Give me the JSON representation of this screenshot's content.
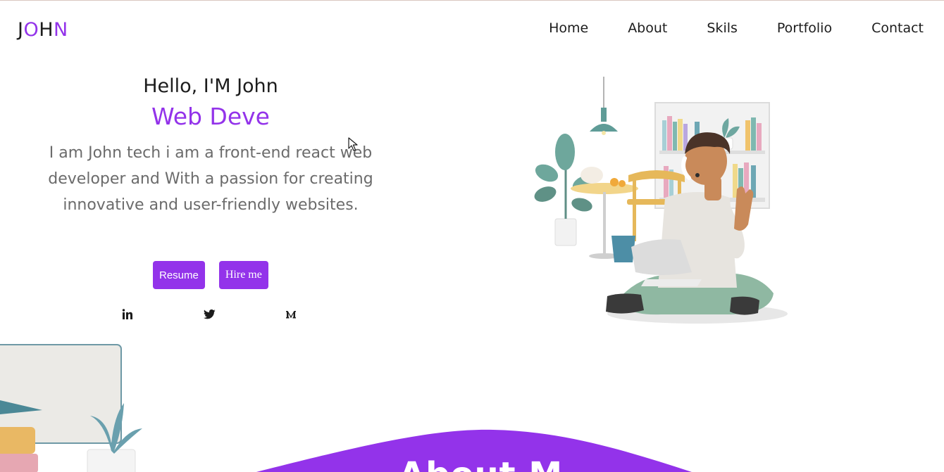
{
  "logo": {
    "letters": [
      "J",
      "O",
      "H",
      "N"
    ]
  },
  "nav": {
    "items": [
      "Home",
      "About",
      "Skils",
      "Portfolio",
      "Contact"
    ]
  },
  "hero": {
    "greeting": "Hello, I'M John",
    "role": "Web Deve",
    "description": "I am John tech i am a front-end react web developer and With a passion for creating innovative and user-friendly websites.",
    "resume_label": "Resume",
    "hire_label": "Hire me"
  },
  "socials": [
    "linkedin-icon",
    "twitter-icon",
    "medium-icon"
  ],
  "about_peek": "About M",
  "colors": {
    "accent": "#9333ea",
    "text": "#1c1c1c",
    "muted": "#6b6b6b"
  }
}
